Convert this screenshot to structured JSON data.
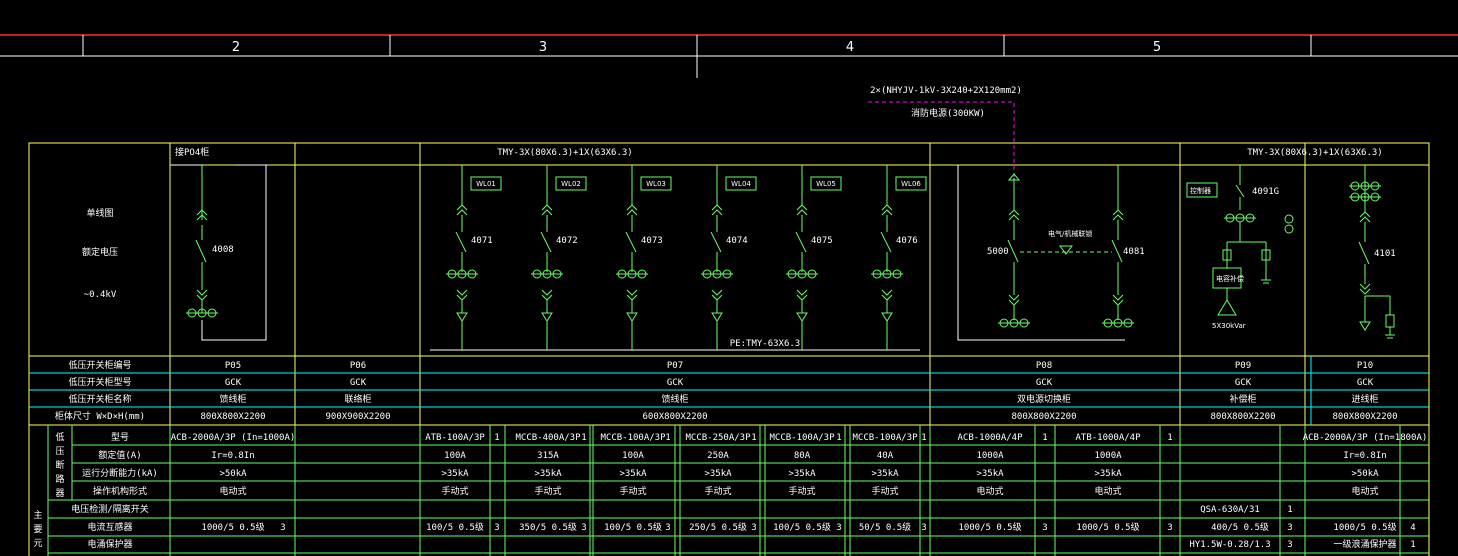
{
  "ruler": {
    "zones": [
      "2",
      "3",
      "4",
      "5"
    ]
  },
  "feeder": {
    "cable": "2×(NHYJV-1kV-3X240+2X120mm2)",
    "load": "消防电源(300KW)"
  },
  "left_labels": {
    "single_line": "单线图",
    "rated_voltage": "额定电压",
    "voltage_value": "~0.4kV"
  },
  "busbars": {
    "main": "TMY-3X(80X6.3)+1X(63X6.3)",
    "right": "TMY-3X(80X6.3)+1X(63X6.3)",
    "pe": "PE:TMY-63X6.3",
    "incoming": "接PO4柜"
  },
  "breakers": {
    "p05": "4008",
    "p07": [
      "4071",
      "4072",
      "4073",
      "4074",
      "4075",
      "4076"
    ],
    "p08": [
      "5000",
      "4081"
    ],
    "p09": "4091G",
    "p10": "4101"
  },
  "tags": {
    "p07": [
      "WL01",
      "WL02",
      "WL03",
      "WL04",
      "WL05",
      "WL06"
    ],
    "p09_reactor": "控制器",
    "p09_comp": "电容补偿",
    "p09_kvar": "5X30kVar",
    "interlock": "电气/机械联锁"
  },
  "header_rows": [
    {
      "label": "低压开关柜编号",
      "p05": "P05",
      "p06": "P06",
      "p07": "P07",
      "p08": "P08",
      "p09": "P09",
      "p10": "P10"
    },
    {
      "label": "低压开关柜型号",
      "p05": "GCK",
      "p06": "GCK",
      "p07": "GCK",
      "p08": "GCK",
      "p09": "GCK",
      "p10": "GCK"
    },
    {
      "label": "低压开关柜名称",
      "p05": "馈线柜",
      "p06": "联络柜",
      "p07": "馈线柜",
      "p08": "双电源切换柜",
      "p09": "补偿柜",
      "p10": "进线柜"
    },
    {
      "label": "柜体尺寸 W×D×H(mm)",
      "p05": "800X800X2200",
      "p06": "900X900X2200",
      "p07": "600X800X2200",
      "p08": "800X800X2200",
      "p09": "800X800X2200",
      "p10": "800X800X2200"
    }
  ],
  "breaker_rows": [
    {
      "label": "型号",
      "cells": [
        "ACB-2000A/3P (In=1000A)",
        "ATB-100A/3P",
        "MCCB-400A/3P",
        "MCCB-100A/3P",
        "MCCB-250A/3P",
        "MCCB-100A/3P",
        "MCCB-100A/3P",
        "ACB-1000A/4P",
        "ATB-1000A/4P",
        "",
        "ACB-2000A/3P (In=1800A)"
      ],
      "qty": [
        "1",
        "1",
        "1",
        "1",
        "1",
        "1",
        "1",
        "1"
      ]
    },
    {
      "label": "额定值(A)",
      "cells": [
        "Ir=0.8In",
        "100A",
        "315A",
        "100A",
        "250A",
        "80A",
        "40A",
        "1000A",
        "1000A",
        "",
        "Ir=0.8In"
      ],
      "qty": []
    },
    {
      "label": "运行分断能力(kA)",
      "cells": [
        ">50kA",
        ">35kA",
        ">35kA",
        ">35kA",
        ">35kA",
        ">35kA",
        ">35kA",
        ">35kA",
        ">35kA",
        "",
        ">50kA"
      ],
      "qty": []
    },
    {
      "label": "操作机构形式",
      "cells": [
        "电动式",
        "手动式",
        "手动式",
        "手动式",
        "手动式",
        "手动式",
        "手动式",
        "电动式",
        "电动式",
        "",
        "电动式"
      ],
      "qty": []
    }
  ],
  "lower_rows": [
    {
      "label": "电压检测/隔离开关",
      "p09": "QSA-630A/31",
      "p09_qty": "1"
    },
    {
      "label": "电流互感器",
      "cells": [
        "1000/5 0.5级",
        "100/5 0.5级",
        "350/5 0.5级",
        "100/5 0.5级",
        "250/5 0.5级",
        "100/5 0.5级",
        "50/5 0.5级",
        "1000/5 0.5级",
        "1000/5 0.5级",
        "400/5 0.5级",
        "1000/5 0.5级"
      ],
      "qty": [
        "3",
        "3",
        "3",
        "3",
        "3",
        "3",
        "3",
        "3",
        "3",
        "3",
        "4"
      ]
    },
    {
      "label": "电涌保护器",
      "p09": "HY1.5W-0.28/1.3",
      "p09_qty": "3",
      "p10": "一级浪涌保护器",
      "p10_qty": "1"
    }
  ],
  "side_group": {
    "switch": [
      "低",
      "压",
      "断",
      "路",
      "器"
    ],
    "main": [
      "主",
      "要",
      "元"
    ]
  },
  "colors": {
    "frame": "#ffff66",
    "grid": "#00ffff",
    "wire": "#66ff66",
    "red": "#ff2a2a",
    "dash": "#ff00ff",
    "text": "#ffffff"
  }
}
